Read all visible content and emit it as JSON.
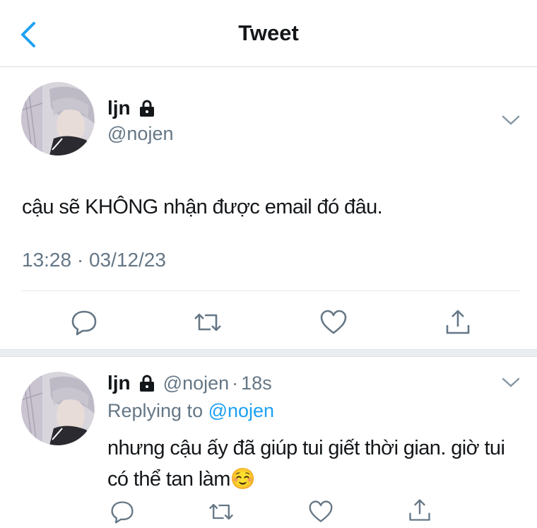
{
  "header": {
    "title": "Tweet",
    "back_icon": "chevron-left-icon",
    "accent": "#1da1f2"
  },
  "tweet": {
    "name": "ljn",
    "lock_icon": "lock-icon",
    "handle": "@nojen",
    "text": "cậu sẽ KHÔNG nhận được email đó đâu.",
    "timestamp": "13:28 · 03/12/23",
    "actions": [
      "reply-icon",
      "retweet-icon",
      "like-icon",
      "share-icon"
    ]
  },
  "reply": {
    "name": "ljn",
    "handle": "@nojen",
    "dot": "·",
    "age": "18s",
    "replying_prefix": "Replying to ",
    "replying_handle": "@nojen",
    "text": "nhưng cậu ấy đã giúp tui giết thời gian. giờ tui có thể tan làm☺️"
  }
}
